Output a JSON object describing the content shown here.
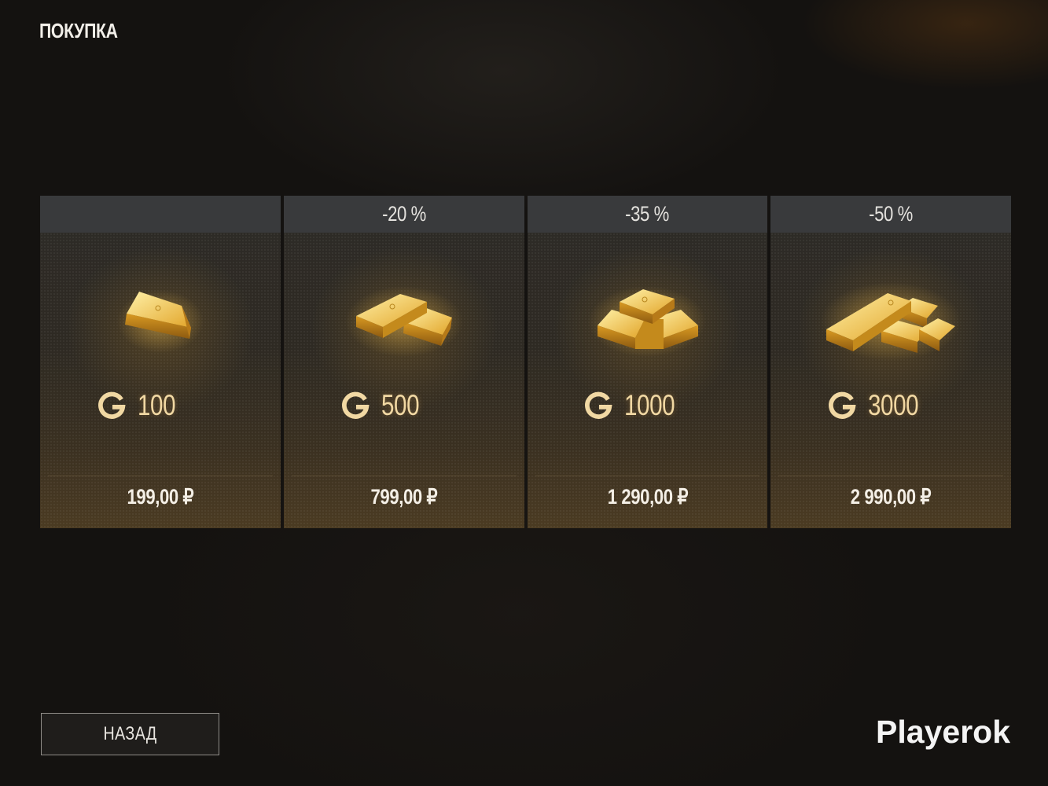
{
  "header": {
    "title": "ПОКУПКА"
  },
  "cards": [
    {
      "discount": "",
      "amount": "100",
      "price": "199,00 ₽",
      "bars": 1
    },
    {
      "discount": "-20 %",
      "amount": "500",
      "price": "799,00 ₽",
      "bars": 2
    },
    {
      "discount": "-35 %",
      "amount": "1000",
      "price": "1 290,00 ₽",
      "bars": 3
    },
    {
      "discount": "-50 %",
      "amount": "3000",
      "price": "2 990,00 ₽",
      "bars": 4
    }
  ],
  "footer": {
    "back_label": "НАЗАД"
  },
  "watermark": {
    "text": "Playerok"
  },
  "colors": {
    "gold": "#f1d8a3",
    "card_header": "#393a3c",
    "background": "#141210"
  },
  "icons": {
    "currency": "gold-g-icon",
    "art": "gold-bar-icon"
  }
}
